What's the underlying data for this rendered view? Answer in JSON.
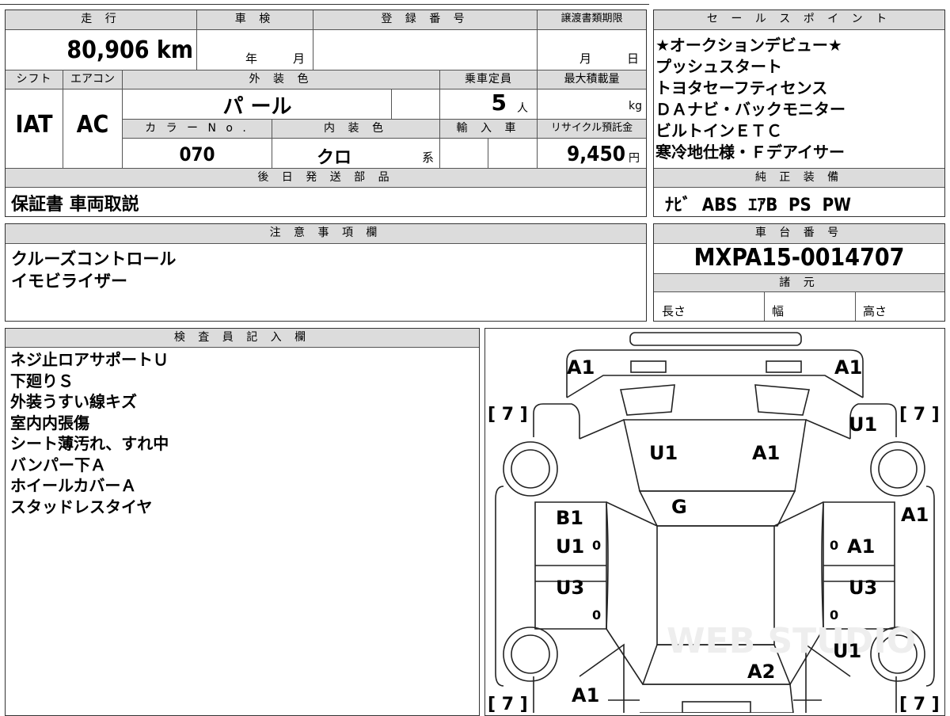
{
  "header_labels": {
    "mileage": "走 行",
    "inspection": "車 検",
    "registration": "登 録 番 号",
    "transfer_deadline": "譲渡書類期限",
    "shift": "シフト",
    "aircon": "エアコン",
    "exterior_color": "外 装 色",
    "capacity": "乗車定員",
    "max_load": "最大積載量",
    "color_no": "カ ラ ー N o .",
    "interior_color": "内 装 色",
    "import": "輸 入 車",
    "recycle": "リサイクル預託金",
    "later_parts": "後 日 発 送 部 品",
    "notes": "注 意 事 項 欄",
    "inspector": "検 査 員 記 入 欄",
    "sales_points": "セ ー ル ス ポ イ ン ト",
    "genuine_equipment": "純 正 装 備",
    "chassis": "車 台 番 号",
    "specs": "諸 元"
  },
  "vehicle": {
    "mileage": "80,906 km",
    "inspection_year_unit": "年",
    "inspection_month_unit": "月",
    "deadline_month_unit": "月",
    "deadline_day_unit": "日",
    "shift": "IAT",
    "aircon": "AC",
    "exterior_color": "パ ール",
    "capacity_value": "5",
    "capacity_unit": "人",
    "load_unit": "kg",
    "color_no": "070",
    "interior_color": "クロ",
    "interior_suffix": "系",
    "recycle_value": "9,450",
    "recycle_unit": "円"
  },
  "later_parts": "保証書 車両取説",
  "notes": "クルーズコントロール\nイモビライザー",
  "sales_points": "★オークションデビュー★\nプッシュスタート\nトヨタセーフティセンス\nＤＡナビ・バックモニター\nビルトインＥＴＣ\n寒冷地仕様・Ｆデアイサー",
  "genuine_equipment": "ﾅﾋﾞ  ABS  ｴｱB  PS  PW",
  "chassis_number": "MXPA15-0014707",
  "specs": {
    "length": "長さ",
    "width": "幅",
    "height": "高さ"
  },
  "inspector_notes": "ネジ止ロアサポートＵ\n下廻りＳ\n外装うすい線キズ\n室内内張傷\nシート薄汚れ、すれ中\nバンパー下Ａ\nホイールカバーＡ\nスタッドレスタイヤ",
  "diagram": {
    "marks": {
      "front_left": "A1",
      "front_right": "A1",
      "hood_left": "U1",
      "hood_right": "A1",
      "fender_right": "U1",
      "windshield": "G",
      "left_door_front_1": "B1",
      "left_door_front_2": "U1",
      "left_door_rear": "U3",
      "right_door_front": "A1",
      "right_pillar": "A1",
      "right_door_rear": "U3",
      "rear_right": "U1",
      "trunk": "A2",
      "rear_left": "A1"
    },
    "tire_labels": {
      "fl": "[ 7 ]",
      "fr": "[ 7 ]",
      "rl": "[ 7 ]",
      "rr": "[ 7 ]"
    },
    "zero": "0",
    "watermark": "WEB STUDIO"
  }
}
